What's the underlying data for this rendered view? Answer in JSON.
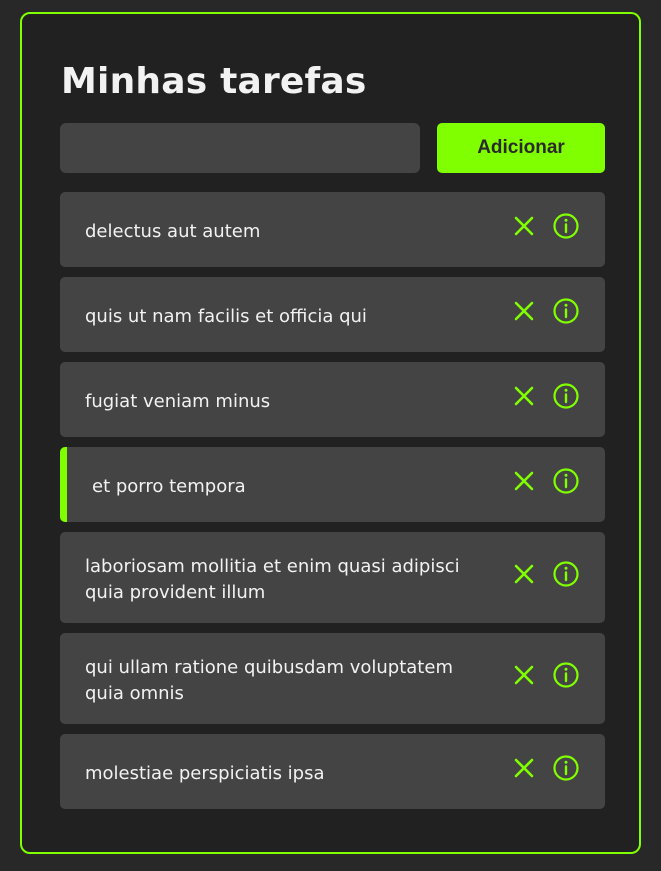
{
  "header": {
    "title": "Minhas tarefas"
  },
  "form": {
    "input_value": "",
    "input_placeholder": "",
    "add_label": "Adicionar"
  },
  "colors": {
    "accent": "#80ff00",
    "panel_bg": "#212121",
    "item_bg": "#444444",
    "text": "#f2f2f2"
  },
  "icons": {
    "remove": "close-icon",
    "details": "info-icon"
  },
  "tasks": [
    {
      "title": "delectus aut autem",
      "active": false
    },
    {
      "title": "quis ut nam facilis et officia qui",
      "active": false
    },
    {
      "title": "fugiat veniam minus",
      "active": false
    },
    {
      "title": "et porro tempora",
      "active": true
    },
    {
      "title": "laboriosam mollitia et enim quasi adipisci quia provident illum",
      "active": false
    },
    {
      "title": "qui ullam ratione quibusdam voluptatem quia omnis",
      "active": false
    },
    {
      "title": "molestiae perspiciatis ipsa",
      "active": false
    }
  ]
}
